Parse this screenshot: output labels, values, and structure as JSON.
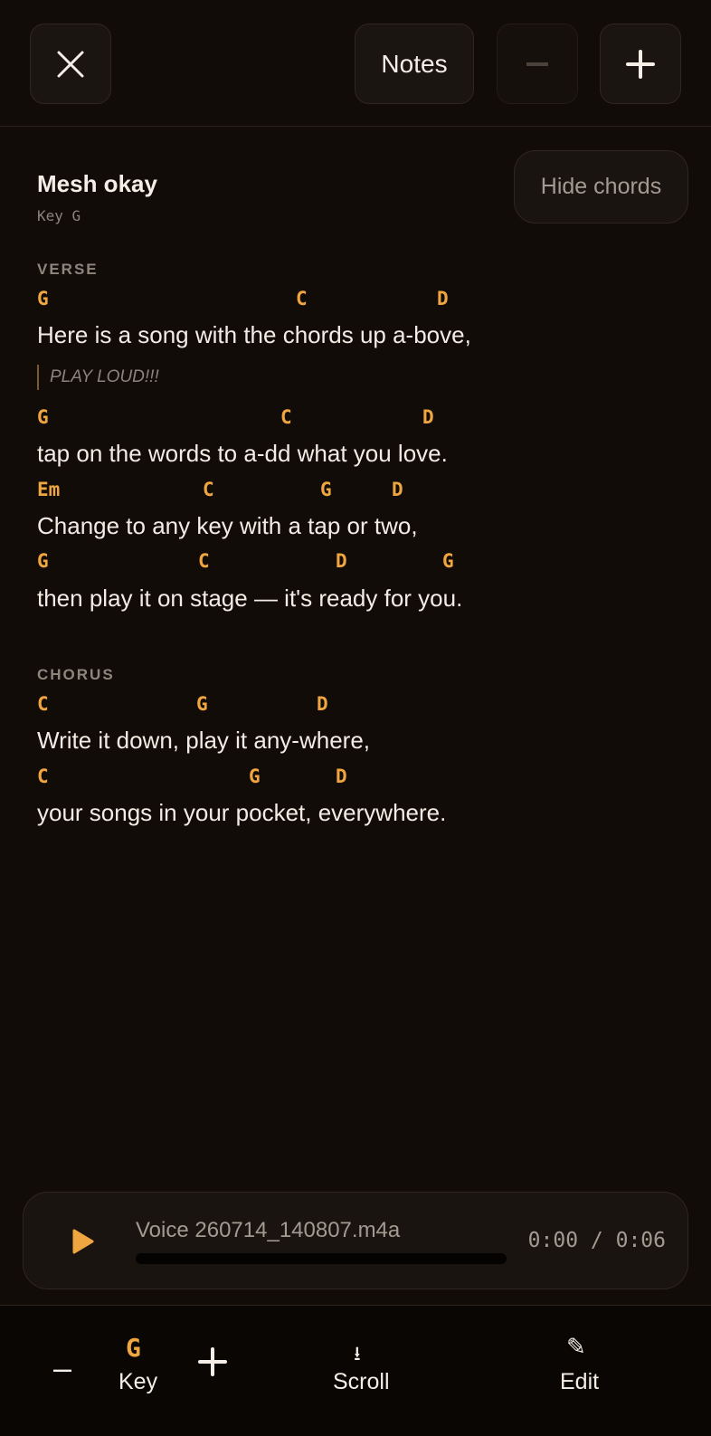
{
  "toolbar": {
    "close_icon": "close-icon",
    "notes_label": "Notes",
    "minus_icon": "minus-icon",
    "plus_icon": "plus-icon"
  },
  "song": {
    "title": "Mesh okay",
    "key_line": "Key G",
    "hide_chords_label": "Hide chords"
  },
  "sections": [
    {
      "label": "VERSE"
    },
    {
      "label": "CHORUS"
    }
  ],
  "lines": [
    {
      "chords": [
        {
          "c": "G"
        },
        {
          "c": "C"
        },
        {
          "c": "D"
        }
      ],
      "lyric": "Here is a song with the chords up a-bove,"
    },
    {
      "chords": [
        {
          "c": "G"
        },
        {
          "c": "C"
        },
        {
          "c": "D"
        }
      ],
      "lyric": "tap on the words to a-dd what you love."
    },
    {
      "chords": [
        {
          "c": "Em"
        },
        {
          "c": "C"
        },
        {
          "c": "G"
        },
        {
          "c": "D"
        }
      ],
      "lyric": "Change to any key with a tap or two,"
    },
    {
      "chords": [
        {
          "c": "G"
        },
        {
          "c": "C"
        },
        {
          "c": "D"
        },
        {
          "c": "G"
        }
      ],
      "lyric": "then play it on stage — it's ready for you."
    },
    {
      "chords": [
        {
          "c": "C"
        },
        {
          "c": "G"
        },
        {
          "c": "D"
        }
      ],
      "lyric": "Write it down, play it any-where,"
    },
    {
      "chords": [
        {
          "c": "C"
        },
        {
          "c": "G"
        },
        {
          "c": "D"
        }
      ],
      "lyric": "your songs in your pocket, everywhere."
    }
  ],
  "note": "PLAY LOUD!!!",
  "player": {
    "play_icon": "play-icon",
    "file_name": "Voice 260714_140807.m4a",
    "time": "0:00 / 0:06",
    "progress": 0
  },
  "bottom_bar": {
    "key_minus": "–",
    "key_value": "G",
    "key_label": "Key",
    "scroll_icon": "⭳",
    "scroll_label": "Scroll",
    "edit_icon": "✎",
    "edit_label": "Edit"
  },
  "colors": {
    "background": "#120c08",
    "chord": "#f0a640",
    "text": "#f2ece4",
    "muted": "#8c847c"
  }
}
